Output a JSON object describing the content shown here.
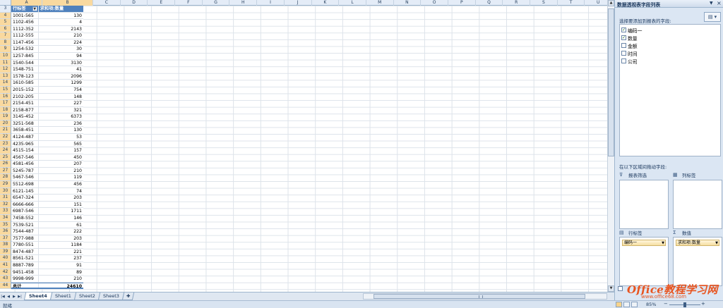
{
  "columns": [
    "A",
    "B",
    "C",
    "D",
    "E",
    "F",
    "G",
    "H",
    "I",
    "J",
    "K",
    "L",
    "M",
    "N",
    "O",
    "P",
    "Q",
    "R",
    "S",
    "T",
    "U"
  ],
  "rows": [
    "3",
    "4",
    "5",
    "6",
    "7",
    "8",
    "9",
    "10",
    "11",
    "12",
    "13",
    "14",
    "15",
    "16",
    "17",
    "18",
    "19",
    "20",
    "21",
    "22",
    "23",
    "24",
    "25",
    "26",
    "27",
    "28",
    "29",
    "30",
    "31",
    "32",
    "33",
    "34",
    "35",
    "36",
    "37",
    "38",
    "39",
    "40",
    "41",
    "42",
    "43",
    "44"
  ],
  "pivot": {
    "row_header": "行标签",
    "value_header": "求和项:数量",
    "data": [
      {
        "code": "1001-565",
        "qty": "130"
      },
      {
        "code": "1102-456",
        "qty": "4"
      },
      {
        "code": "1112-352",
        "qty": "2143"
      },
      {
        "code": "1112-555",
        "qty": "210"
      },
      {
        "code": "1147-456",
        "qty": "224"
      },
      {
        "code": "1254-532",
        "qty": "30"
      },
      {
        "code": "1257-845",
        "qty": "94"
      },
      {
        "code": "1540-544",
        "qty": "3130"
      },
      {
        "code": "1548-751",
        "qty": "41"
      },
      {
        "code": "1578-123",
        "qty": "2096"
      },
      {
        "code": "1610-585",
        "qty": "1299"
      },
      {
        "code": "2015-152",
        "qty": "754"
      },
      {
        "code": "2102-205",
        "qty": "148"
      },
      {
        "code": "2154-451",
        "qty": "227"
      },
      {
        "code": "2158-877",
        "qty": "321"
      },
      {
        "code": "3145-452",
        "qty": "6373"
      },
      {
        "code": "3251-568",
        "qty": "236"
      },
      {
        "code": "3658-451",
        "qty": "130"
      },
      {
        "code": "4124-487",
        "qty": "53"
      },
      {
        "code": "4235-965",
        "qty": "565"
      },
      {
        "code": "4515-154",
        "qty": "157"
      },
      {
        "code": "4567-546",
        "qty": "450"
      },
      {
        "code": "4581-456",
        "qty": "207"
      },
      {
        "code": "5245-787",
        "qty": "210"
      },
      {
        "code": "5467-546",
        "qty": "119"
      },
      {
        "code": "5512-698",
        "qty": "456"
      },
      {
        "code": "6121-145",
        "qty": "74"
      },
      {
        "code": "6547-324",
        "qty": "203"
      },
      {
        "code": "6666-666",
        "qty": "151"
      },
      {
        "code": "6987-546",
        "qty": "1711"
      },
      {
        "code": "7458-552",
        "qty": "146"
      },
      {
        "code": "7539-521",
        "qty": "61"
      },
      {
        "code": "7544-487",
        "qty": "222"
      },
      {
        "code": "7577-988",
        "qty": "203"
      },
      {
        "code": "7780-551",
        "qty": "1184"
      },
      {
        "code": "8474-487",
        "qty": "221"
      },
      {
        "code": "8561-521",
        "qty": "237"
      },
      {
        "code": "8887-789",
        "qty": "91"
      },
      {
        "code": "9451-458",
        "qty": "89"
      },
      {
        "code": "9998-999",
        "qty": "210"
      }
    ],
    "total_label": "总计",
    "total_value": "24610"
  },
  "sheet_tabs": [
    "Sheet4",
    "Sheet1",
    "Sheet2",
    "Sheet3"
  ],
  "active_tab": "Sheet4",
  "status": {
    "text": "就绪",
    "zoom": "85%"
  },
  "field_list": {
    "title": "数据透视表字段列表",
    "choose_label": "选择要添加到报表的字段:",
    "fields": [
      {
        "name": "编码一",
        "checked": true
      },
      {
        "name": "数量",
        "checked": true
      },
      {
        "name": "金额",
        "checked": false
      },
      {
        "name": "时间",
        "checked": false
      },
      {
        "name": "公司",
        "checked": false
      }
    ],
    "drag_label": "在以下区域间拖动字段:",
    "areas": {
      "filter": {
        "label": "报表筛选"
      },
      "columns": {
        "label": "列标签"
      },
      "rows": {
        "label": "行标签",
        "chip": "编码一"
      },
      "values": {
        "label": "数值",
        "chip": "求和项:数量"
      }
    }
  },
  "watermark": {
    "main": "Office教程学习网",
    "sub": "www.office68.com"
  }
}
